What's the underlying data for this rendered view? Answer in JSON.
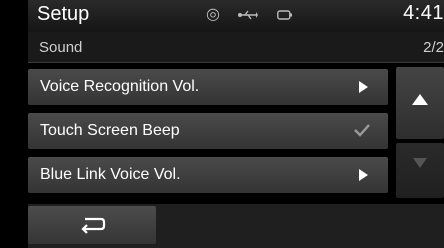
{
  "statusbar": {
    "title": "Setup",
    "clock": "4:41",
    "icons": [
      "gps-icon",
      "usb-icon",
      "battery-icon"
    ]
  },
  "subheader": {
    "title": "Sound",
    "page": "2/2"
  },
  "list": {
    "items": [
      {
        "label": "Voice Recognition Vol.",
        "control": "arrow"
      },
      {
        "label": "Touch Screen Beep",
        "control": "checkbox",
        "checked": true
      },
      {
        "label": "Blue Link Voice Vol.",
        "control": "arrow"
      }
    ]
  },
  "scroll": {
    "up_enabled": true,
    "down_enabled": false
  },
  "footer": {
    "back_icon": "back-arrow-icon"
  }
}
